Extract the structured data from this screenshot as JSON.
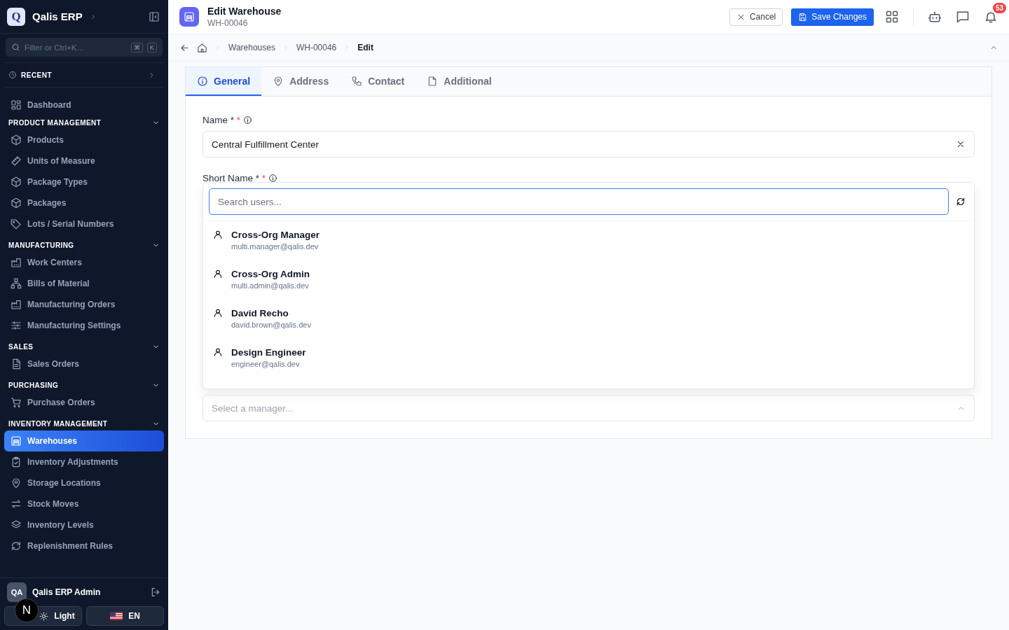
{
  "sidebar": {
    "brand": {
      "logo": "Q",
      "name": "Qalis ERP"
    },
    "search": {
      "placeholder": "Filter or Ctrl+K...",
      "keys": [
        "⌘",
        "K"
      ]
    },
    "recent": {
      "label": "RECENT"
    },
    "top_items": [
      {
        "label": "Dashboard",
        "selected": false
      }
    ],
    "sections": [
      {
        "title": "PRODUCT MANAGEMENT",
        "expanded": true,
        "items": [
          {
            "label": "Products",
            "selected": false
          },
          {
            "label": "Units of Measure",
            "selected": false
          },
          {
            "label": "Package Types",
            "selected": false
          },
          {
            "label": "Packages",
            "selected": false
          },
          {
            "label": "Lots / Serial Numbers",
            "selected": false
          }
        ]
      },
      {
        "title": "MANUFACTURING",
        "expanded": true,
        "items": [
          {
            "label": "Work Centers",
            "selected": false
          },
          {
            "label": "Bills of Material",
            "selected": false
          },
          {
            "label": "Manufacturing Orders",
            "selected": false
          },
          {
            "label": "Manufacturing Settings",
            "selected": false
          }
        ]
      },
      {
        "title": "SALES",
        "expanded": true,
        "items": [
          {
            "label": "Sales Orders",
            "selected": false
          }
        ]
      },
      {
        "title": "PURCHASING",
        "expanded": true,
        "items": [
          {
            "label": "Purchase Orders",
            "selected": false
          }
        ]
      },
      {
        "title": "INVENTORY MANAGEMENT",
        "expanded": true,
        "items": [
          {
            "label": "Warehouses",
            "selected": true
          },
          {
            "label": "Inventory Adjustments",
            "selected": false
          },
          {
            "label": "Storage Locations",
            "selected": false
          },
          {
            "label": "Stock Moves",
            "selected": false
          },
          {
            "label": "Inventory Levels",
            "selected": false
          },
          {
            "label": "Replenishment Rules",
            "selected": false
          }
        ]
      }
    ],
    "user": {
      "initials": "QA",
      "name": "Qalis ERP Admin"
    },
    "theme_button": "Light",
    "language_button": "EN",
    "dev_badge": "N"
  },
  "header": {
    "title": "Edit Warehouse",
    "subtitle": "WH-00046",
    "cancel": "Cancel",
    "save": "Save Changes",
    "notifications": "53"
  },
  "breadcrumb": [
    "Warehouses",
    "WH-00046",
    "Edit"
  ],
  "tabs": [
    {
      "label": "General",
      "selected": true
    },
    {
      "label": "Address",
      "selected": false
    },
    {
      "label": "Contact",
      "selected": false
    },
    {
      "label": "Additional",
      "selected": false
    }
  ],
  "form": {
    "name": {
      "label": "Name *",
      "required_mark": "*",
      "value": "Central Fulfillment Center"
    },
    "short_name": {
      "label": "Short Name *",
      "required_mark": "*"
    },
    "manager": {
      "placeholder": "Select a manager..."
    }
  },
  "user_dropdown": {
    "search_placeholder": "Search users...",
    "options": [
      {
        "name": "Cross-Org Manager",
        "email": "multi.manager@qalis.dev"
      },
      {
        "name": "Cross-Org Admin",
        "email": "multi.admin@qalis.dev"
      },
      {
        "name": "David Recho",
        "email": "david.brown@qalis.dev"
      },
      {
        "name": "Design Engineer",
        "email": "engineer@qalis.dev"
      }
    ]
  }
}
